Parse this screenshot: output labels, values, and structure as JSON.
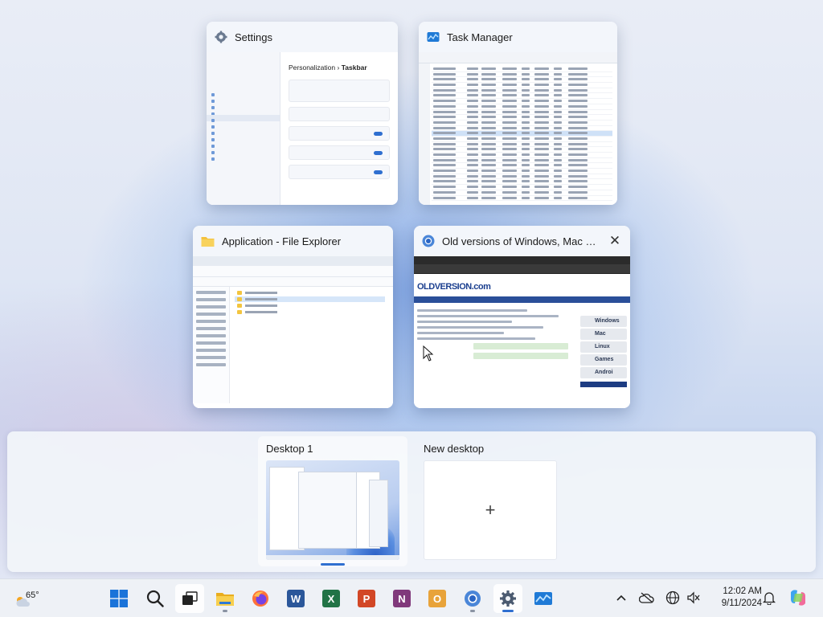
{
  "windows": {
    "settings": {
      "title": "Settings",
      "breadcrumb_parent": "Personalization",
      "breadcrumb_current": "Taskbar"
    },
    "task_manager": {
      "title": "Task Manager"
    },
    "file_explorer": {
      "title": "Application - File Explorer"
    },
    "browser": {
      "title": "Old versions of Windows, Mac a...",
      "site_logo": "OLDVERSION.com",
      "os_links": [
        "Windows",
        "Mac",
        "Linux",
        "Games",
        "Androi"
      ]
    }
  },
  "desktops": {
    "current": {
      "label": "Desktop 1"
    },
    "new": {
      "label": "New desktop",
      "plus": "+"
    }
  },
  "taskbar": {
    "weather": {
      "temp": "65°"
    },
    "clock": {
      "time": "12:02 AM",
      "date": "9/11/2024"
    },
    "apps": [
      {
        "name": "Start",
        "glyph": ""
      },
      {
        "name": "Search",
        "glyph": ""
      },
      {
        "name": "Task View",
        "glyph": ""
      },
      {
        "name": "File Explorer",
        "glyph": ""
      },
      {
        "name": "Firefox",
        "glyph": ""
      },
      {
        "name": "Word",
        "glyph": "W"
      },
      {
        "name": "Excel",
        "glyph": "X"
      },
      {
        "name": "PowerPoint",
        "glyph": "P"
      },
      {
        "name": "OneNote",
        "glyph": "N"
      },
      {
        "name": "Outlook",
        "glyph": "O"
      },
      {
        "name": "Chrome",
        "glyph": ""
      },
      {
        "name": "Settings",
        "glyph": "⚙"
      },
      {
        "name": "Task Manager",
        "glyph": ""
      }
    ]
  },
  "colors": {
    "accent": "#2f6fd0",
    "word": "#2b579a",
    "excel": "#217346",
    "powerpoint": "#d24726",
    "onenote": "#80397b",
    "outlook": "#e8a33a"
  }
}
